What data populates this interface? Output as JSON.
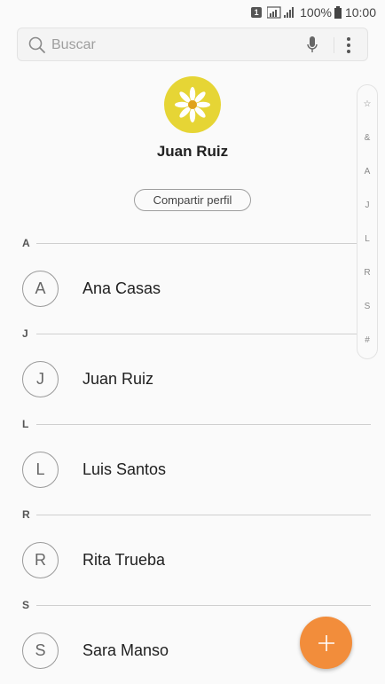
{
  "status_bar": {
    "sim_label": "1",
    "battery_percent": "100%",
    "time": "10:00"
  },
  "search": {
    "placeholder": "Buscar",
    "icon": "search-icon",
    "mic_icon": "mic-icon",
    "more_icon": "more-vert-icon"
  },
  "profile": {
    "name": "Juan Ruiz",
    "share_label": "Compartir perfil",
    "avatar_icon": "daisy-flower"
  },
  "index_rail": [
    "☆",
    "&",
    "A",
    "J",
    "L",
    "R",
    "S",
    "#"
  ],
  "sections": [
    {
      "letter": "A",
      "contacts": [
        {
          "initial": "A",
          "name": "Ana Casas"
        }
      ]
    },
    {
      "letter": "J",
      "contacts": [
        {
          "initial": "J",
          "name": "Juan Ruiz"
        }
      ]
    },
    {
      "letter": "L",
      "contacts": [
        {
          "initial": "L",
          "name": "Luis Santos"
        }
      ]
    },
    {
      "letter": "R",
      "contacts": [
        {
          "initial": "R",
          "name": "Rita Trueba"
        }
      ]
    },
    {
      "letter": "S",
      "contacts": [
        {
          "initial": "S",
          "name": "Sara Manso"
        }
      ]
    }
  ],
  "fab": {
    "icon": "add-icon"
  },
  "colors": {
    "fab": "#f28d3b",
    "avatar_bg": "#e6d535"
  }
}
